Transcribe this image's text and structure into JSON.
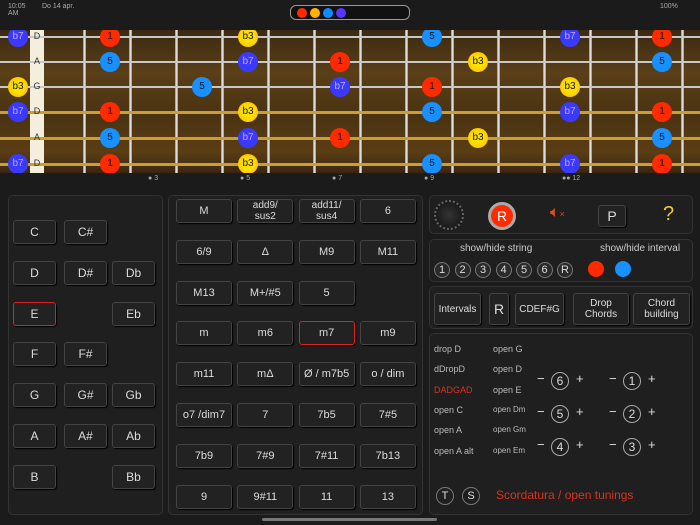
{
  "status": {
    "time": "10:05 AM",
    "date": "Do 14 apr.",
    "battery": "100%"
  },
  "palette": [
    "#ff2a00",
    "#ffb300",
    "#0a8cff",
    "#5a33ff"
  ],
  "interval_colors": {
    "1": "#ff2a00",
    "b3": "#ffb000",
    "5": "#1890ff",
    "b7": "#3a3aff"
  },
  "strings": [
    "D",
    "A",
    "G",
    "D",
    "A",
    "D"
  ],
  "notes": [
    {
      "s": 0,
      "f": 0,
      "l": "b7"
    },
    {
      "s": 0,
      "f": 2,
      "l": "1"
    },
    {
      "s": 0,
      "f": 5,
      "l": "b3"
    },
    {
      "s": 0,
      "f": 9,
      "l": "5"
    },
    {
      "s": 0,
      "f": 12,
      "l": "b7"
    },
    {
      "s": 0,
      "f": 14,
      "l": "1"
    },
    {
      "s": 1,
      "f": 2,
      "l": "5"
    },
    {
      "s": 1,
      "f": 5,
      "l": "b7"
    },
    {
      "s": 1,
      "f": 7,
      "l": "1"
    },
    {
      "s": 1,
      "f": 10,
      "l": "b3"
    },
    {
      "s": 1,
      "f": 14,
      "l": "5"
    },
    {
      "s": 2,
      "f": 0,
      "l": "b3"
    },
    {
      "s": 2,
      "f": 4,
      "l": "5"
    },
    {
      "s": 2,
      "f": 7,
      "l": "b7"
    },
    {
      "s": 2,
      "f": 9,
      "l": "1"
    },
    {
      "s": 2,
      "f": 12,
      "l": "b3"
    },
    {
      "s": 3,
      "f": 0,
      "l": "b7"
    },
    {
      "s": 3,
      "f": 2,
      "l": "1"
    },
    {
      "s": 3,
      "f": 5,
      "l": "b3"
    },
    {
      "s": 3,
      "f": 9,
      "l": "5"
    },
    {
      "s": 3,
      "f": 12,
      "l": "b7"
    },
    {
      "s": 3,
      "f": 14,
      "l": "1"
    },
    {
      "s": 4,
      "f": 2,
      "l": "5"
    },
    {
      "s": 4,
      "f": 5,
      "l": "b7"
    },
    {
      "s": 4,
      "f": 7,
      "l": "1"
    },
    {
      "s": 4,
      "f": 10,
      "l": "b3"
    },
    {
      "s": 4,
      "f": 14,
      "l": "5"
    },
    {
      "s": 5,
      "f": 0,
      "l": "b7"
    },
    {
      "s": 5,
      "f": 2,
      "l": "1"
    },
    {
      "s": 5,
      "f": 5,
      "l": "b3"
    },
    {
      "s": 5,
      "f": 9,
      "l": "5"
    },
    {
      "s": 5,
      "f": 12,
      "l": "b7"
    },
    {
      "s": 5,
      "f": 14,
      "l": "1"
    }
  ],
  "fret_markers": [
    {
      "f": 3,
      "l": "3",
      "d": 1
    },
    {
      "f": 5,
      "l": "5",
      "d": 1
    },
    {
      "f": 7,
      "l": "7",
      "d": 1
    },
    {
      "f": 9,
      "l": "9",
      "d": 1
    },
    {
      "f": 12,
      "l": "12",
      "d": 2
    }
  ],
  "keys": [
    [
      "C",
      "C#",
      ""
    ],
    [
      "D",
      "D#",
      "Db"
    ],
    [
      "E",
      "",
      "Eb"
    ],
    [
      "F",
      "F#",
      ""
    ],
    [
      "G",
      "G#",
      "Gb"
    ],
    [
      "A",
      "A#",
      "Ab"
    ],
    [
      "B",
      "",
      "Bb"
    ]
  ],
  "selected_key": "E",
  "chords": [
    [
      "M",
      "add9/\nsus2",
      "add11/\nsus4",
      "6"
    ],
    [
      "6/9",
      "Δ",
      "M9",
      "M11"
    ],
    [
      "M13",
      "M+/#5",
      "5",
      ""
    ],
    [
      "m",
      "m6",
      "m7",
      "m9"
    ],
    [
      "m11",
      "mΔ",
      "Ø / m7b5",
      "o / dim"
    ],
    [
      "o7 /dim7",
      "7",
      "7b5",
      "7#5"
    ],
    [
      "7b9",
      "7#9",
      "7#11",
      "7b13"
    ],
    [
      "9",
      "9#11",
      "11",
      "13"
    ]
  ],
  "selected_chord": "m7",
  "toolbar": {
    "record": "R",
    "p": "P",
    "help": "?"
  },
  "show": {
    "string_label": "show/hide string",
    "interval_label": "show/hide interval",
    "strings": [
      "1",
      "2",
      "3",
      "4",
      "5",
      "6",
      "R"
    ],
    "interval_dots": [
      "#ff2a00",
      "#1890ff"
    ]
  },
  "modes": {
    "intervals": "Intervals",
    "r": "R",
    "notes": "CDEF#G",
    "drop": "Drop\nChords",
    "building": "Chord\nbuilding"
  },
  "tunings": {
    "col1": [
      "drop D",
      "dDropD",
      "DADGAD",
      "open C",
      "open A",
      "open A alt"
    ],
    "col2": [
      "open G",
      "open D",
      "open E",
      "open Dm",
      "open Gm",
      "open Em"
    ],
    "selected": "DADGAD",
    "string_adjust": [
      [
        "6",
        "1"
      ],
      [
        "5",
        "2"
      ],
      [
        "4",
        "3"
      ]
    ],
    "minus": "−",
    "plus": "+",
    "t": "T",
    "s": "S",
    "title": "Scordatura / open tunings"
  }
}
